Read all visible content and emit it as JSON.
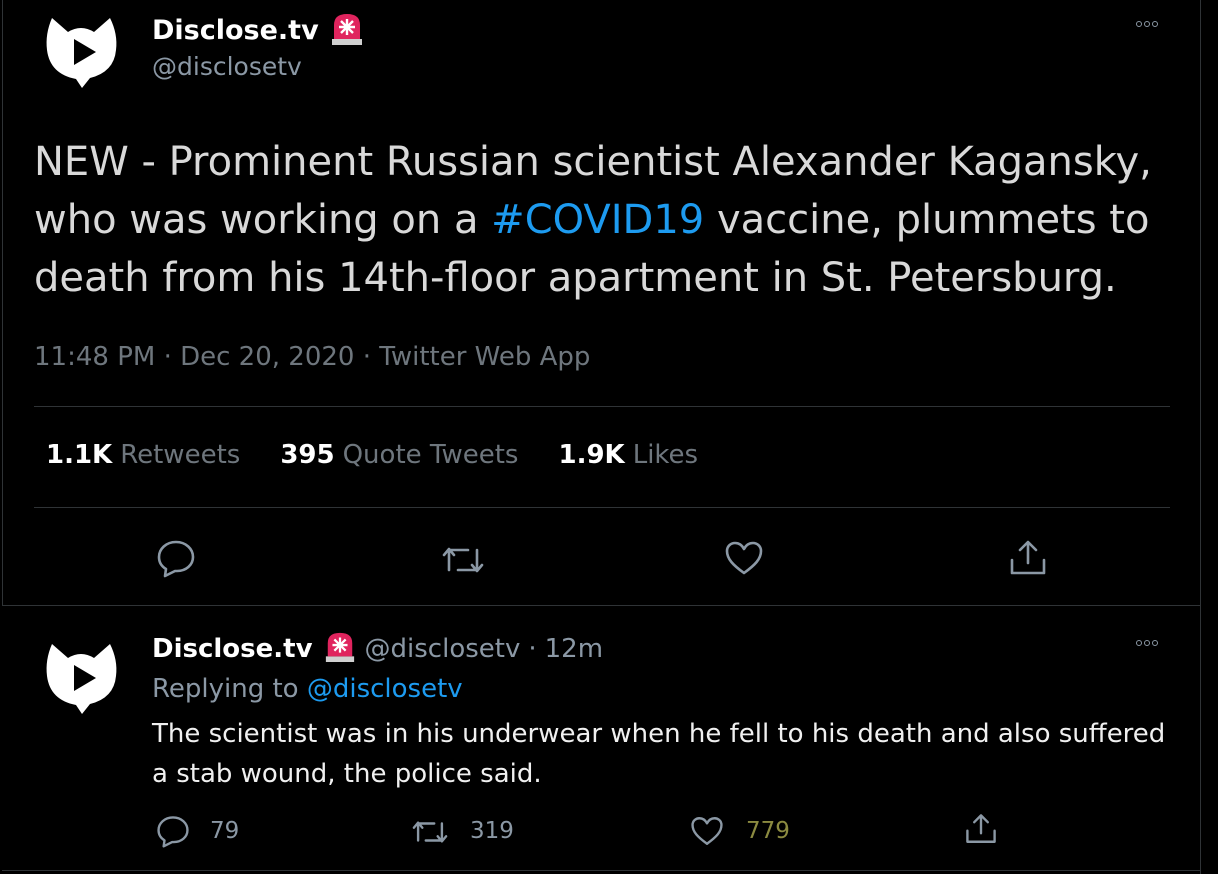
{
  "colors": {
    "background": "#000000",
    "link": "#1d9bf0",
    "muted": "#6e767d",
    "divider": "#2f3336"
  },
  "main_tweet": {
    "author": {
      "name": "Disclose.tv",
      "handle": "@disclosetv",
      "badge_icon": "rotating-light-icon",
      "avatar_icon": "disclosetv-logo"
    },
    "text_part1": "NEW - Prominent Russian scientist Alexander Kagansky, who was working on a ",
    "hashtag": "#COVID19",
    "text_part2": " vaccine, plummets to death from his 14th-floor apartment in St. Petersburg.",
    "timestamp": "11:48 PM · Dec 20, 2020 · Twitter Web App",
    "stats": {
      "retweets_count": "1.1K",
      "retweets_label": "Retweets",
      "quotes_count": "395",
      "quotes_label": "Quote Tweets",
      "likes_count": "1.9K",
      "likes_label": "Likes"
    },
    "actions": [
      "reply-icon",
      "retweet-icon",
      "like-icon",
      "share-icon"
    ]
  },
  "reply_tweet": {
    "author": {
      "name": "Disclose.tv",
      "handle": "@disclosetv",
      "badge_icon": "rotating-light-icon"
    },
    "dot": "·",
    "time": "12m",
    "replying_label": "Replying to",
    "replying_to": "@disclosetv",
    "text": "The scientist was in his underwear when he fell to his death and also suffered a stab wound, the police said.",
    "counts": {
      "replies": "79",
      "retweets": "319",
      "likes": "779"
    }
  }
}
